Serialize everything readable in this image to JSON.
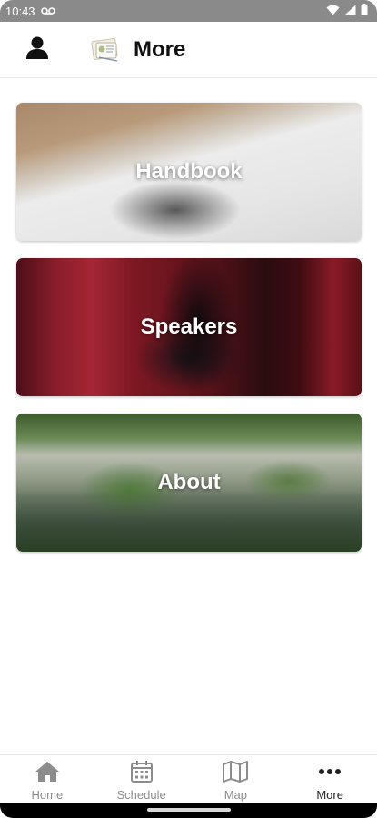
{
  "status_bar": {
    "time": "10:43",
    "icons": [
      "voicemail-icon",
      "wifi-icon",
      "signal-icon",
      "battery-icon"
    ]
  },
  "app_bar": {
    "title": "More",
    "left_icon": "person-icon",
    "logo_icon": "app-logo-icon"
  },
  "cards": [
    {
      "title": "Handbook",
      "image": "book-photo"
    },
    {
      "title": "Speakers",
      "image": "podium-photo"
    },
    {
      "title": "About",
      "image": "crowd-photo"
    }
  ],
  "bottom_nav": {
    "items": [
      {
        "label": "Home",
        "icon": "home-icon",
        "active": false
      },
      {
        "label": "Schedule",
        "icon": "calendar-icon",
        "active": false
      },
      {
        "label": "Map",
        "icon": "map-icon",
        "active": false
      },
      {
        "label": "More",
        "icon": "more-horizontal-icon",
        "active": true
      }
    ]
  },
  "colors": {
    "status_bar": "#8a8a8a",
    "nav_inactive": "#8c8c8c",
    "nav_active": "#222222",
    "card_text": "#ffffff"
  }
}
